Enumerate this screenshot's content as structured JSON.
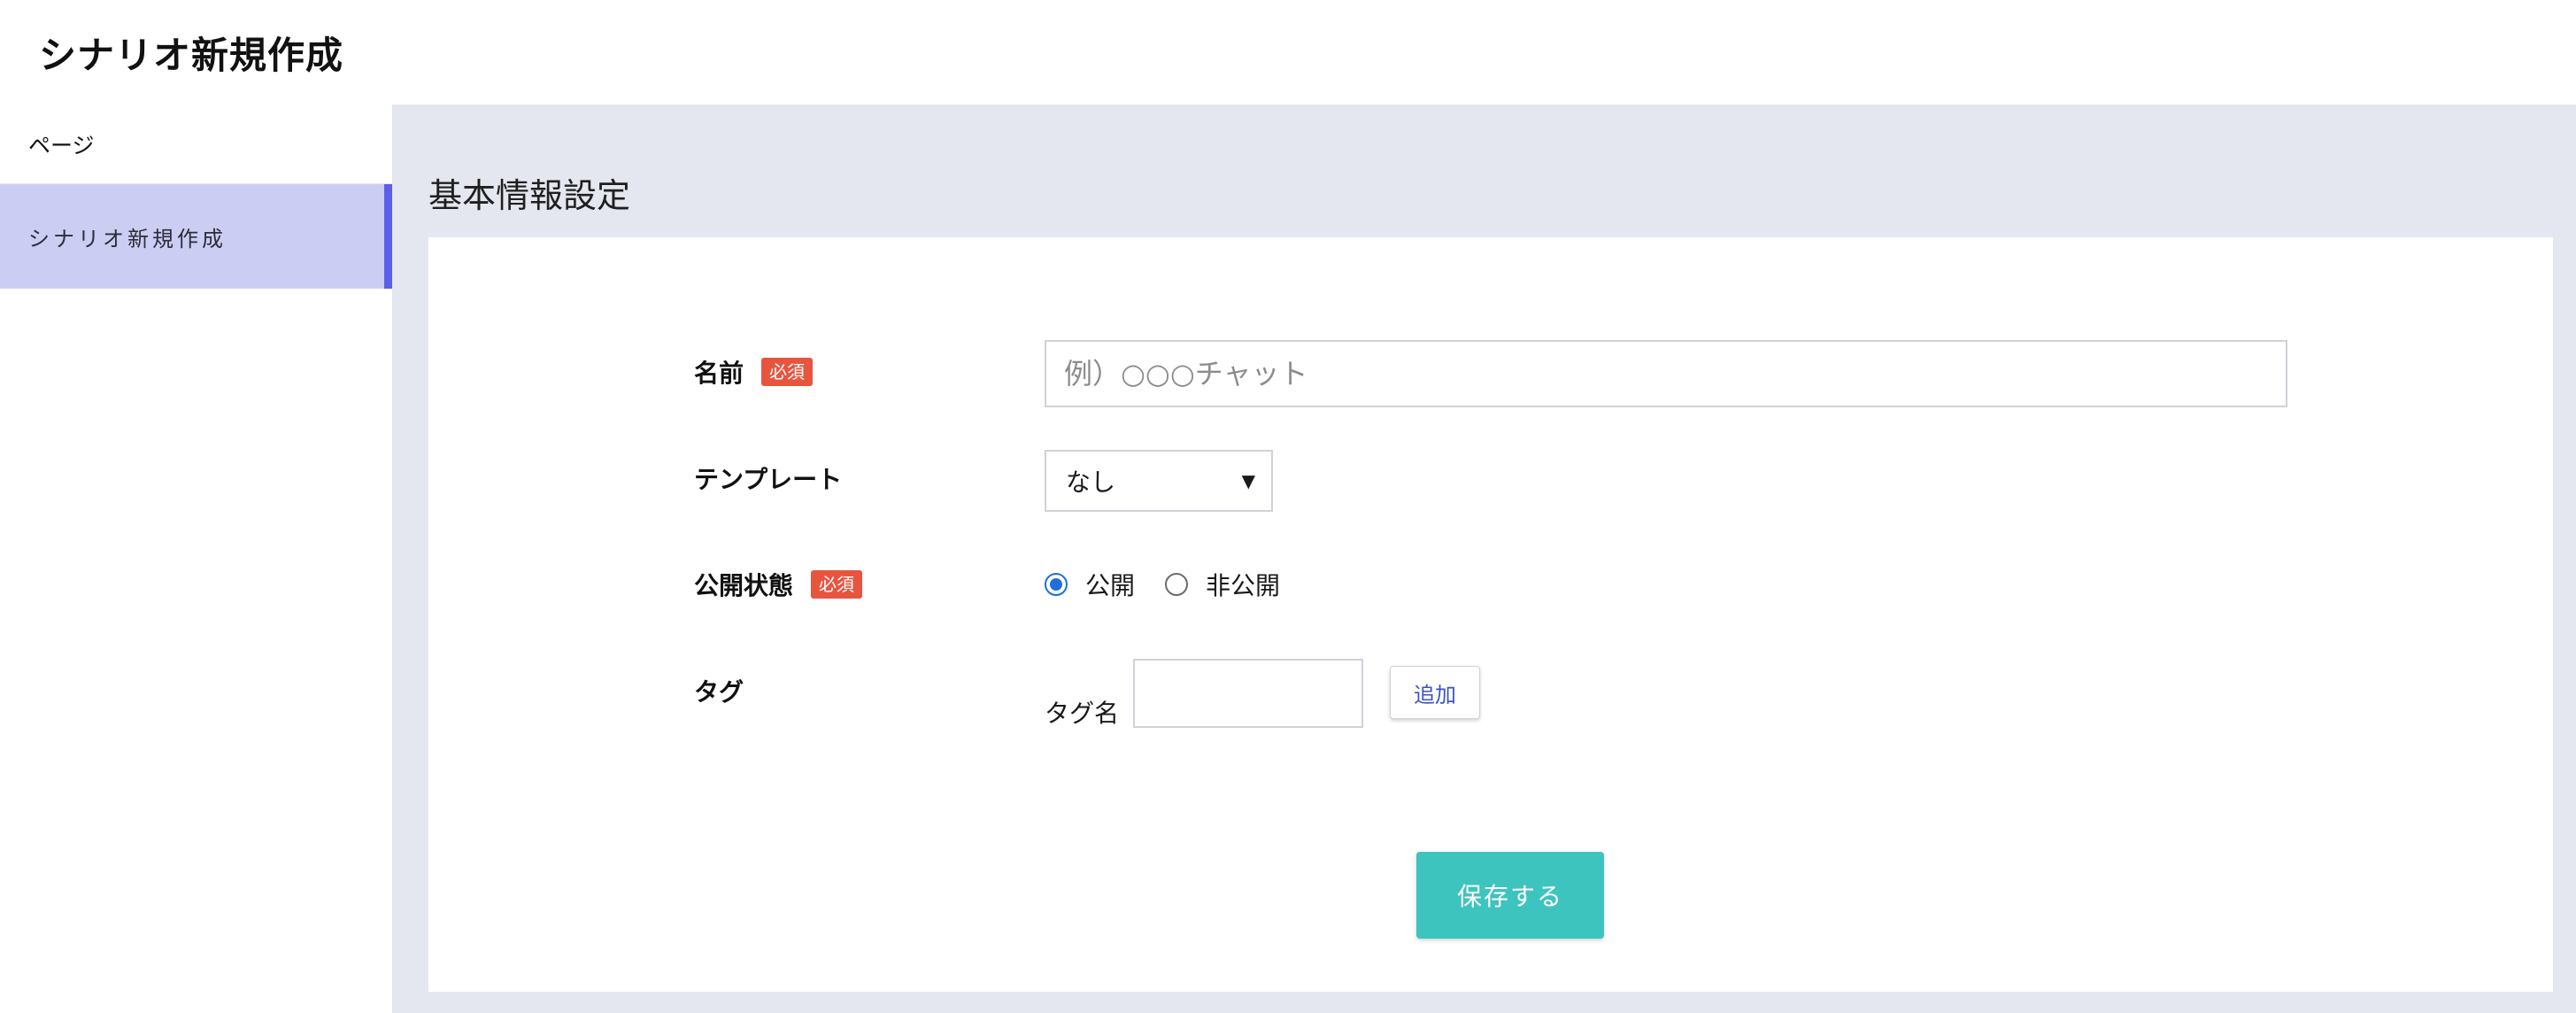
{
  "header": {
    "title": "シナリオ新規作成"
  },
  "sidebar": {
    "heading": "ページ",
    "items": [
      {
        "label": "シナリオ新規作成",
        "active": true
      }
    ]
  },
  "main": {
    "section_title": "基本情報設定",
    "form": {
      "name": {
        "label": "名前",
        "required_badge": "必須",
        "placeholder": "例）○○○チャット",
        "value": ""
      },
      "template": {
        "label": "テンプレート",
        "selected": "なし"
      },
      "visibility": {
        "label": "公開状態",
        "required_badge": "必須",
        "options": [
          {
            "label": "公開",
            "checked": true
          },
          {
            "label": "非公開",
            "checked": false
          }
        ]
      },
      "tag": {
        "label": "タグ",
        "name_label": "タグ名",
        "value": "",
        "add_button": "追加"
      },
      "save_button": "保存する"
    }
  },
  "colors": {
    "sidebar_active_bg": "#cccdf3",
    "sidebar_active_bar": "#5a5ee8",
    "main_bg": "#e4e7ef",
    "required_badge": "#e8553e",
    "save_button": "#3ec4be",
    "radio_checked": "#1f6fd6",
    "add_button_text": "#3d52c8"
  }
}
